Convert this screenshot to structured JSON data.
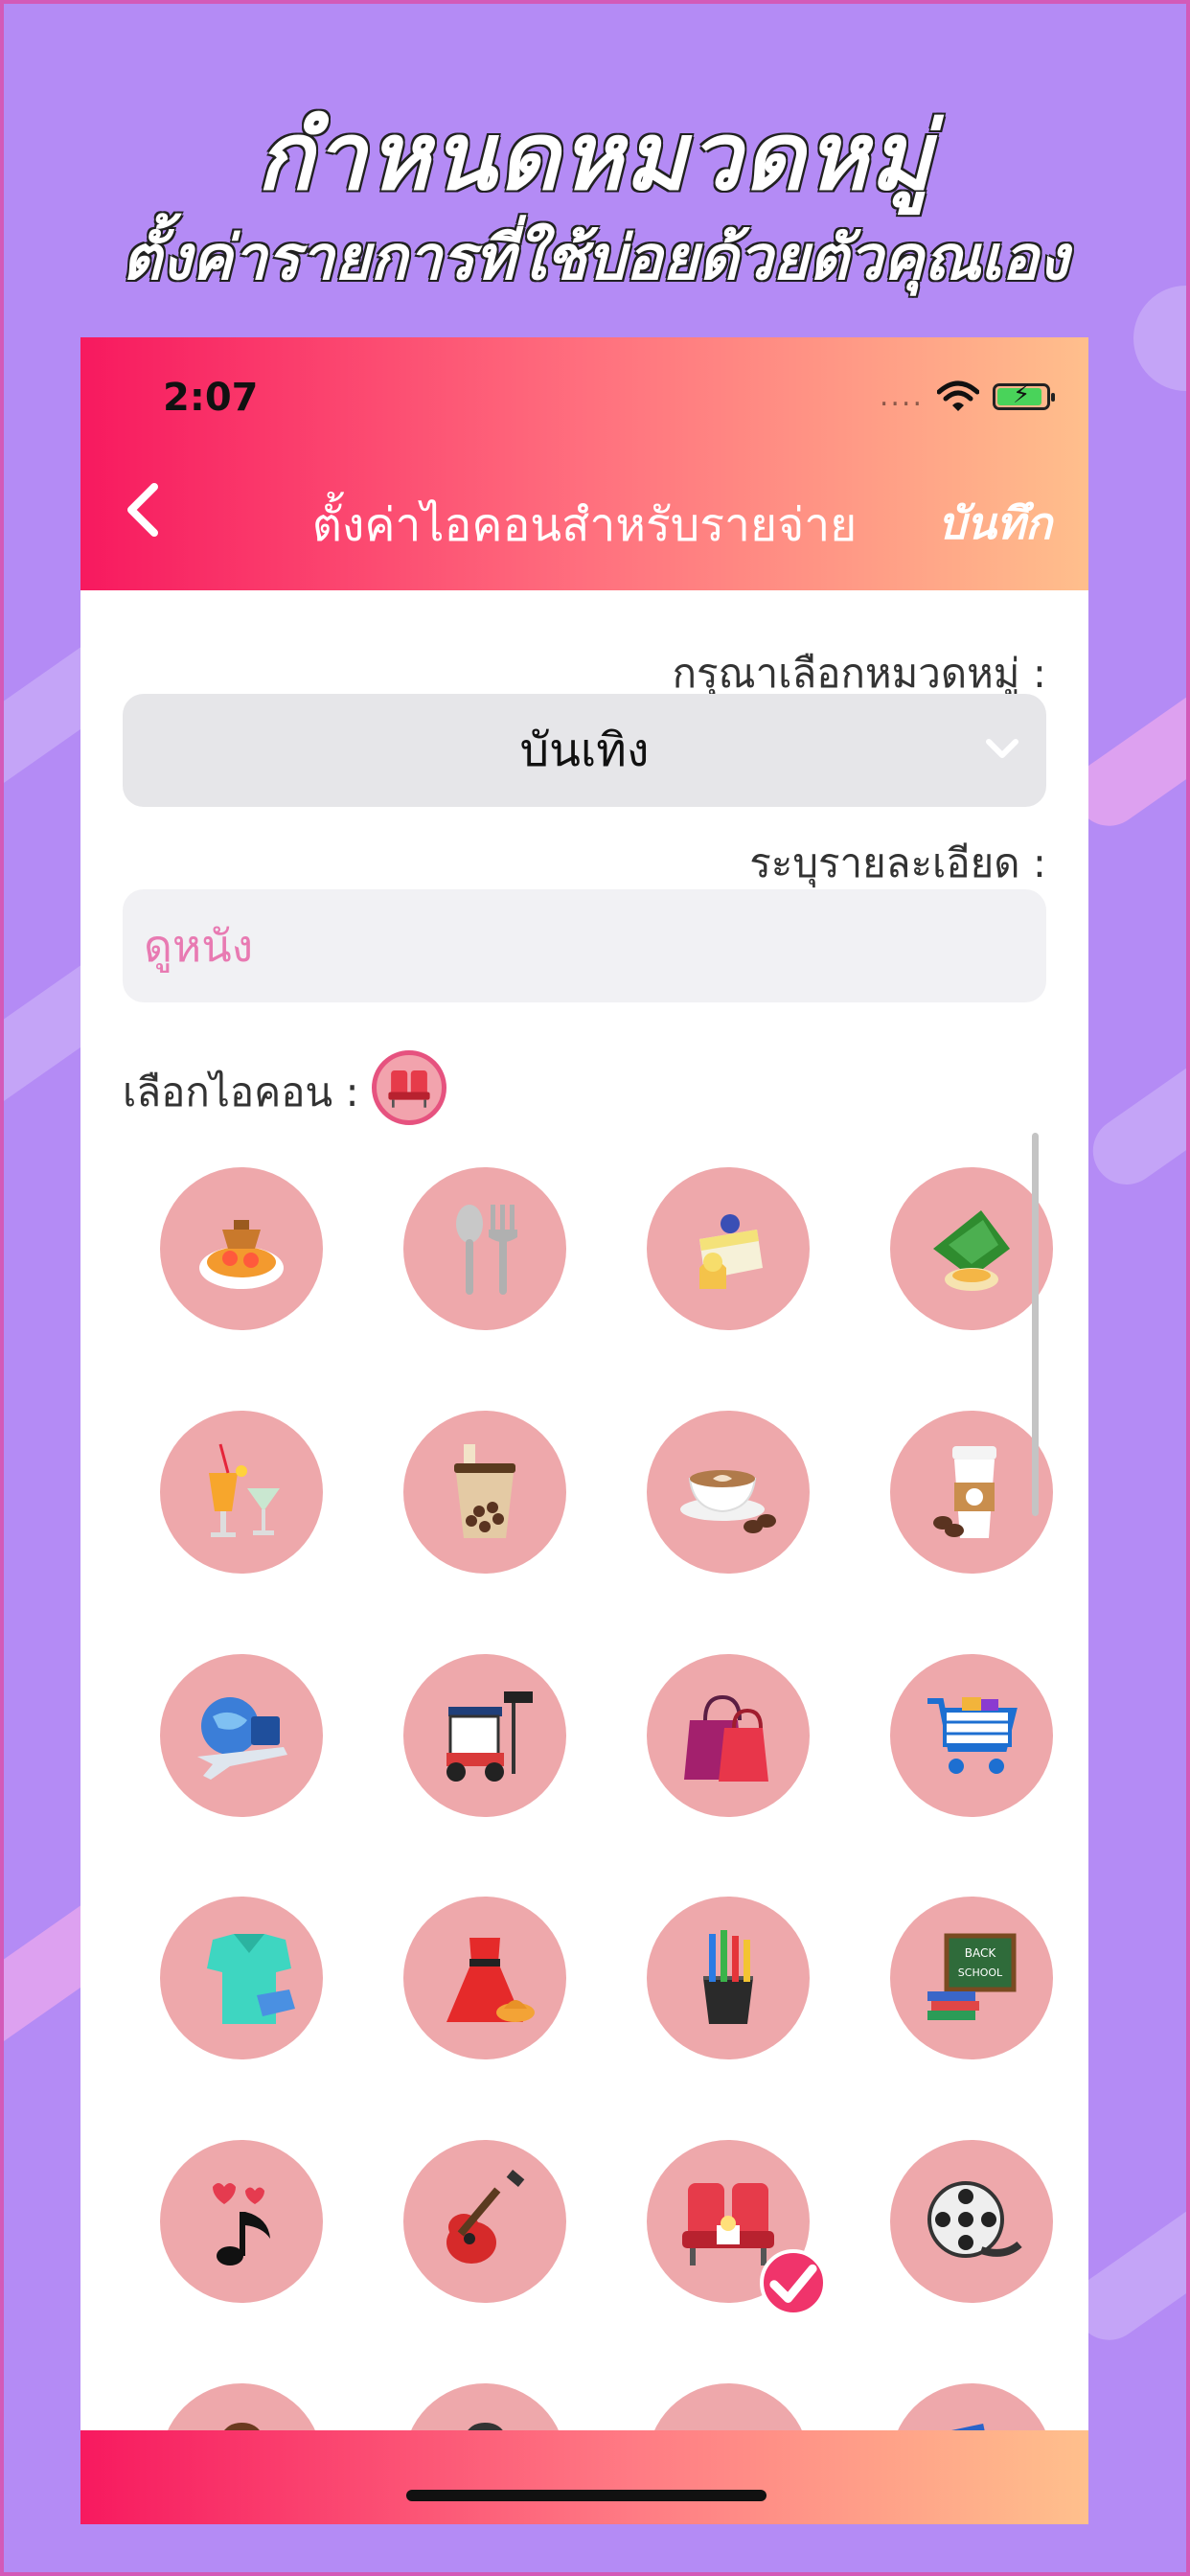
{
  "promo": {
    "headline": "กำหนดหมวดหมู่",
    "subheadline": "ตั้งค่ารายการที่ใช้บ่อยด้วยตัวคุณเอง"
  },
  "status_bar": {
    "time": "2:07",
    "signal_dots": "....",
    "battery_charging": true
  },
  "nav": {
    "back_icon": "chevron-left-icon",
    "title": "ตั้งค่าไอคอนสำหรับรายจ่าย",
    "save_label": "บันทึก"
  },
  "form": {
    "category_label": "กรุณาเลือกหมวดหมู่ :",
    "category_value": "บันเทิง",
    "detail_label": "ระบุรายละเอียด :",
    "detail_placeholder": "ดูหนัง",
    "icon_label": "เลือกไอคอน :",
    "selected_icon": "cinema-seats-icon"
  },
  "icons": [
    "thai-food-icon",
    "spoon-fork-icon",
    "cake-icon",
    "thai-dessert-icon",
    "cocktail-icon",
    "bubble-tea-icon",
    "latte-icon",
    "coffee-cup-icon",
    "travel-icon",
    "tuk-tuk-icon",
    "shopping-bags-icon",
    "shopping-cart-icon",
    "shirt-icon",
    "dress-icon",
    "pencil-cup-icon",
    "back-to-school-icon",
    "music-note-icon",
    "guitar-icon",
    "cinema-seats-icon",
    "film-reel-icon",
    "student-icon",
    "businessman-icon",
    "books-icon",
    "magazine-icon"
  ],
  "selected_index": 18,
  "colors": {
    "accent": "#f7195f",
    "gradient_end": "#ffbf8c",
    "icon_bg": "#eea8ab",
    "background": "#b48bf5"
  }
}
